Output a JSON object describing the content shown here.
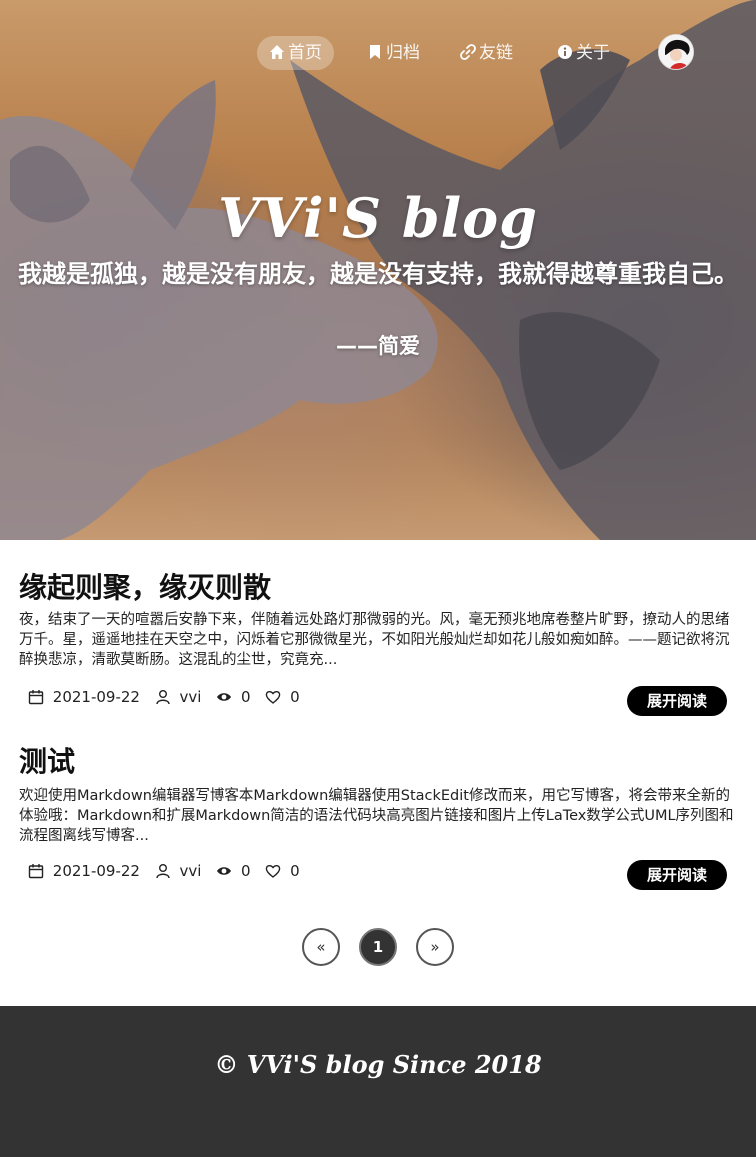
{
  "nav": {
    "items": [
      {
        "label": "首页",
        "icon": "home-icon",
        "active": true
      },
      {
        "label": "归档",
        "icon": "bookmark-icon",
        "active": false
      },
      {
        "label": "友链",
        "icon": "link-icon",
        "active": false
      },
      {
        "label": "关于",
        "icon": "info-icon",
        "active": false
      }
    ]
  },
  "hero": {
    "site_title": "VVi'S blog",
    "quote": "我越是孤独，越是没有朋友，越是没有支持，我就得越尊重我自己。",
    "quote_author": "——简爱"
  },
  "posts": [
    {
      "title": "缘起则聚，缘灭则散",
      "excerpt": "夜，结束了一天的喧嚣后安静下来，伴随着远处路灯那微弱的光。风，毫无预兆地席卷整片旷野，撩动人的思绪万千。星，遥遥地挂在天空之中，闪烁着它那微微星光，不如阳光般灿烂却如花儿般如痴如醉。——题记欲将沉醉换悲凉，清歌莫断肠。这混乱的尘世，究竟充...",
      "date": "2021-09-22",
      "author": "vvi",
      "views": "0",
      "likes": "0",
      "read_label": "展开阅读"
    },
    {
      "title": "测试",
      "excerpt": "欢迎使用Markdown编辑器写博客本Markdown编辑器使用StackEdit修改而来，用它写博客，将会带来全新的体验哦：Markdown和扩展Markdown简洁的语法代码块高亮图片链接和图片上传LaTex数学公式UML序列图和流程图离线写博客...",
      "date": "2021-09-22",
      "author": "vvi",
      "views": "0",
      "likes": "0",
      "read_label": "展开阅读"
    }
  ],
  "pagination": {
    "prev": "«",
    "current": "1",
    "next": "»"
  },
  "footer": {
    "text": "© VVi'S blog Since 2018"
  },
  "colors": {
    "footer_bg": "#333333",
    "button_bg": "#000000",
    "accent": "#ffffff"
  }
}
